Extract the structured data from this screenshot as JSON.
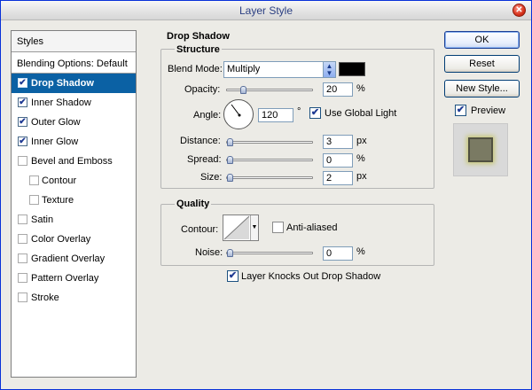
{
  "window": {
    "title": "Layer Style"
  },
  "styles_panel": {
    "header": "Styles",
    "blending_options": "Blending Options: Default",
    "items": [
      {
        "label": "Drop Shadow",
        "checked": true,
        "selected": true,
        "sub": false
      },
      {
        "label": "Inner Shadow",
        "checked": true,
        "selected": false,
        "sub": false
      },
      {
        "label": "Outer Glow",
        "checked": true,
        "selected": false,
        "sub": false
      },
      {
        "label": "Inner Glow",
        "checked": true,
        "selected": false,
        "sub": false
      },
      {
        "label": "Bevel and Emboss",
        "checked": false,
        "selected": false,
        "sub": false
      },
      {
        "label": "Contour",
        "checked": false,
        "selected": false,
        "sub": true
      },
      {
        "label": "Texture",
        "checked": false,
        "selected": false,
        "sub": true
      },
      {
        "label": "Satin",
        "checked": false,
        "selected": false,
        "sub": false
      },
      {
        "label": "Color Overlay",
        "checked": false,
        "selected": false,
        "sub": false
      },
      {
        "label": "Gradient Overlay",
        "checked": false,
        "selected": false,
        "sub": false
      },
      {
        "label": "Pattern Overlay",
        "checked": false,
        "selected": false,
        "sub": false
      },
      {
        "label": "Stroke",
        "checked": false,
        "selected": false,
        "sub": false
      }
    ]
  },
  "drop_shadow": {
    "title": "Drop Shadow",
    "structure": {
      "title": "Structure",
      "blend_mode_label": "Blend Mode:",
      "blend_mode_value": "Multiply",
      "shadow_color": "#000000",
      "opacity_label": "Opacity:",
      "opacity_value": "20",
      "opacity_unit": "%",
      "angle_label": "Angle:",
      "angle_value": "120",
      "angle_unit": "°",
      "use_global_light_label": "Use Global Light",
      "use_global_light_checked": true,
      "distance_label": "Distance:",
      "distance_value": "3",
      "distance_unit": "px",
      "spread_label": "Spread:",
      "spread_value": "0",
      "spread_unit": "%",
      "size_label": "Size:",
      "size_value": "2",
      "size_unit": "px"
    },
    "quality": {
      "title": "Quality",
      "contour_label": "Contour:",
      "anti_aliased_label": "Anti-aliased",
      "anti_aliased_checked": false,
      "noise_label": "Noise:",
      "noise_value": "0",
      "noise_unit": "%"
    },
    "knocks_out_label": "Layer Knocks Out Drop Shadow",
    "knocks_out_checked": true
  },
  "buttons": {
    "ok": "OK",
    "reset": "Reset",
    "new_style": "New Style...",
    "preview_label": "Preview",
    "preview_checked": true
  },
  "icons": {
    "close": "close-icon",
    "check": "checkmark-icon",
    "dropdown": "chevron-updown-icon"
  },
  "colors": {
    "selection": "#0b61a4",
    "title_text": "#2b3f82"
  }
}
